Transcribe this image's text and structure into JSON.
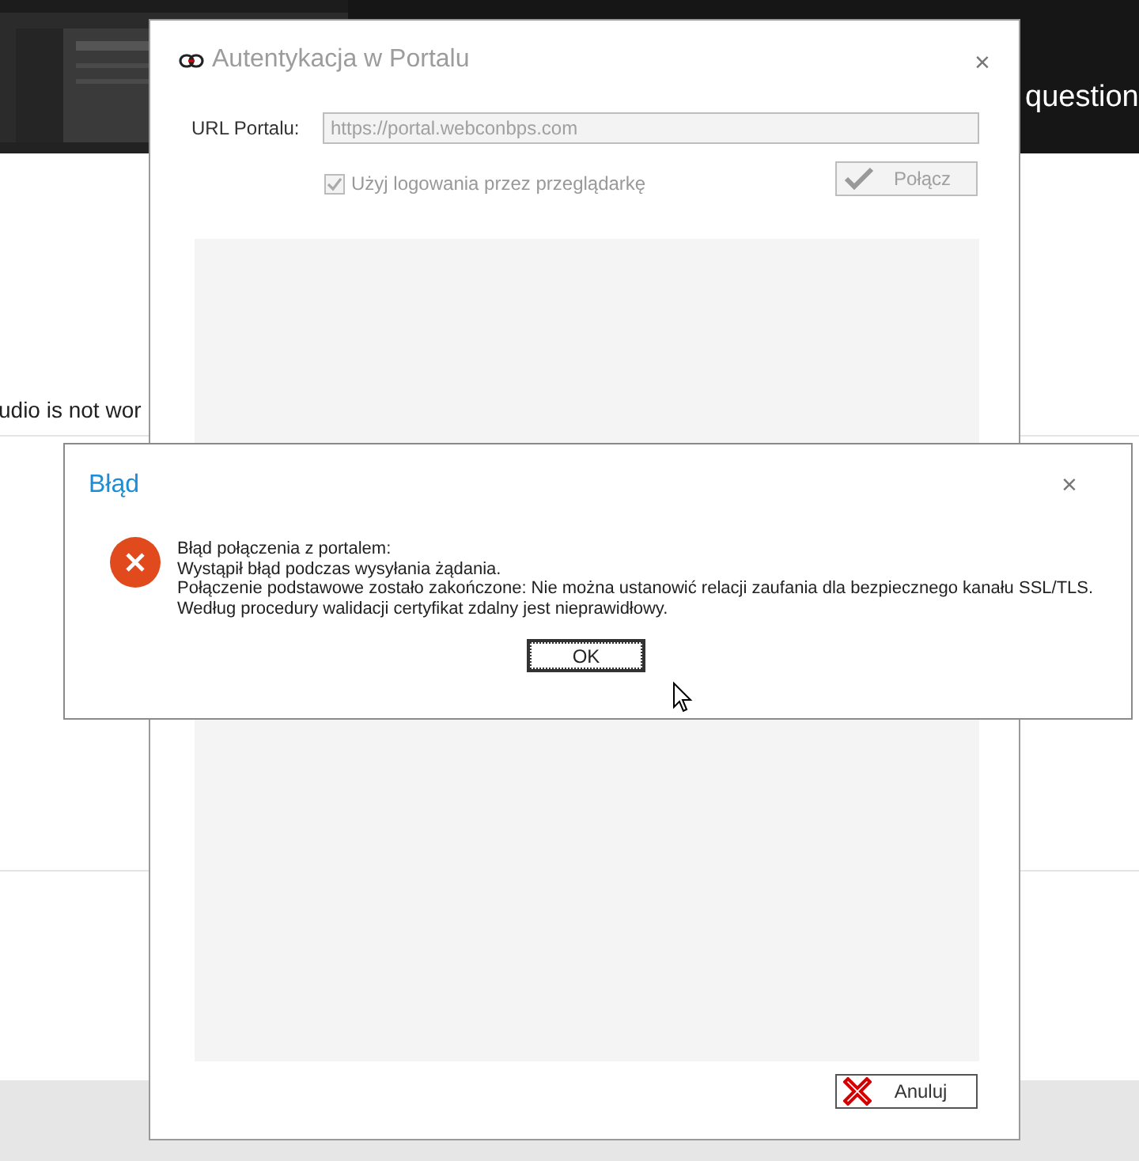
{
  "background_page": {
    "banner": {
      "subtitle": "question"
    },
    "post_snippet": "udio is not wor"
  },
  "auth_dialog": {
    "title": "Autentykacja w Portalu",
    "close": "×",
    "url_label": "URL Portalu:",
    "url_value": "https://portal.webconbps.com",
    "url_disabled": true,
    "browser_login": {
      "label": "Użyj logowania przez przeglądarkę",
      "checked": true,
      "disabled": true
    },
    "connect_button": {
      "label": "Połącz",
      "disabled": true
    },
    "cancel_button": {
      "label": "Anuluj",
      "disabled": false
    }
  },
  "error_dialog": {
    "title": "Błąd",
    "close": "×",
    "message": [
      "Błąd połączenia z portalem:",
      "Wystąpił błąd podczas wysyłania żądania.",
      "Połączenie podstawowe zostało zakończone: Nie można ustanowić relacji zaufania dla bezpiecznego kanału SSL/TLS.",
      "Według procedury walidacji certyfikat zdalny jest nieprawidłowy."
    ],
    "ok_button": {
      "label": "OK",
      "focused": true
    }
  }
}
